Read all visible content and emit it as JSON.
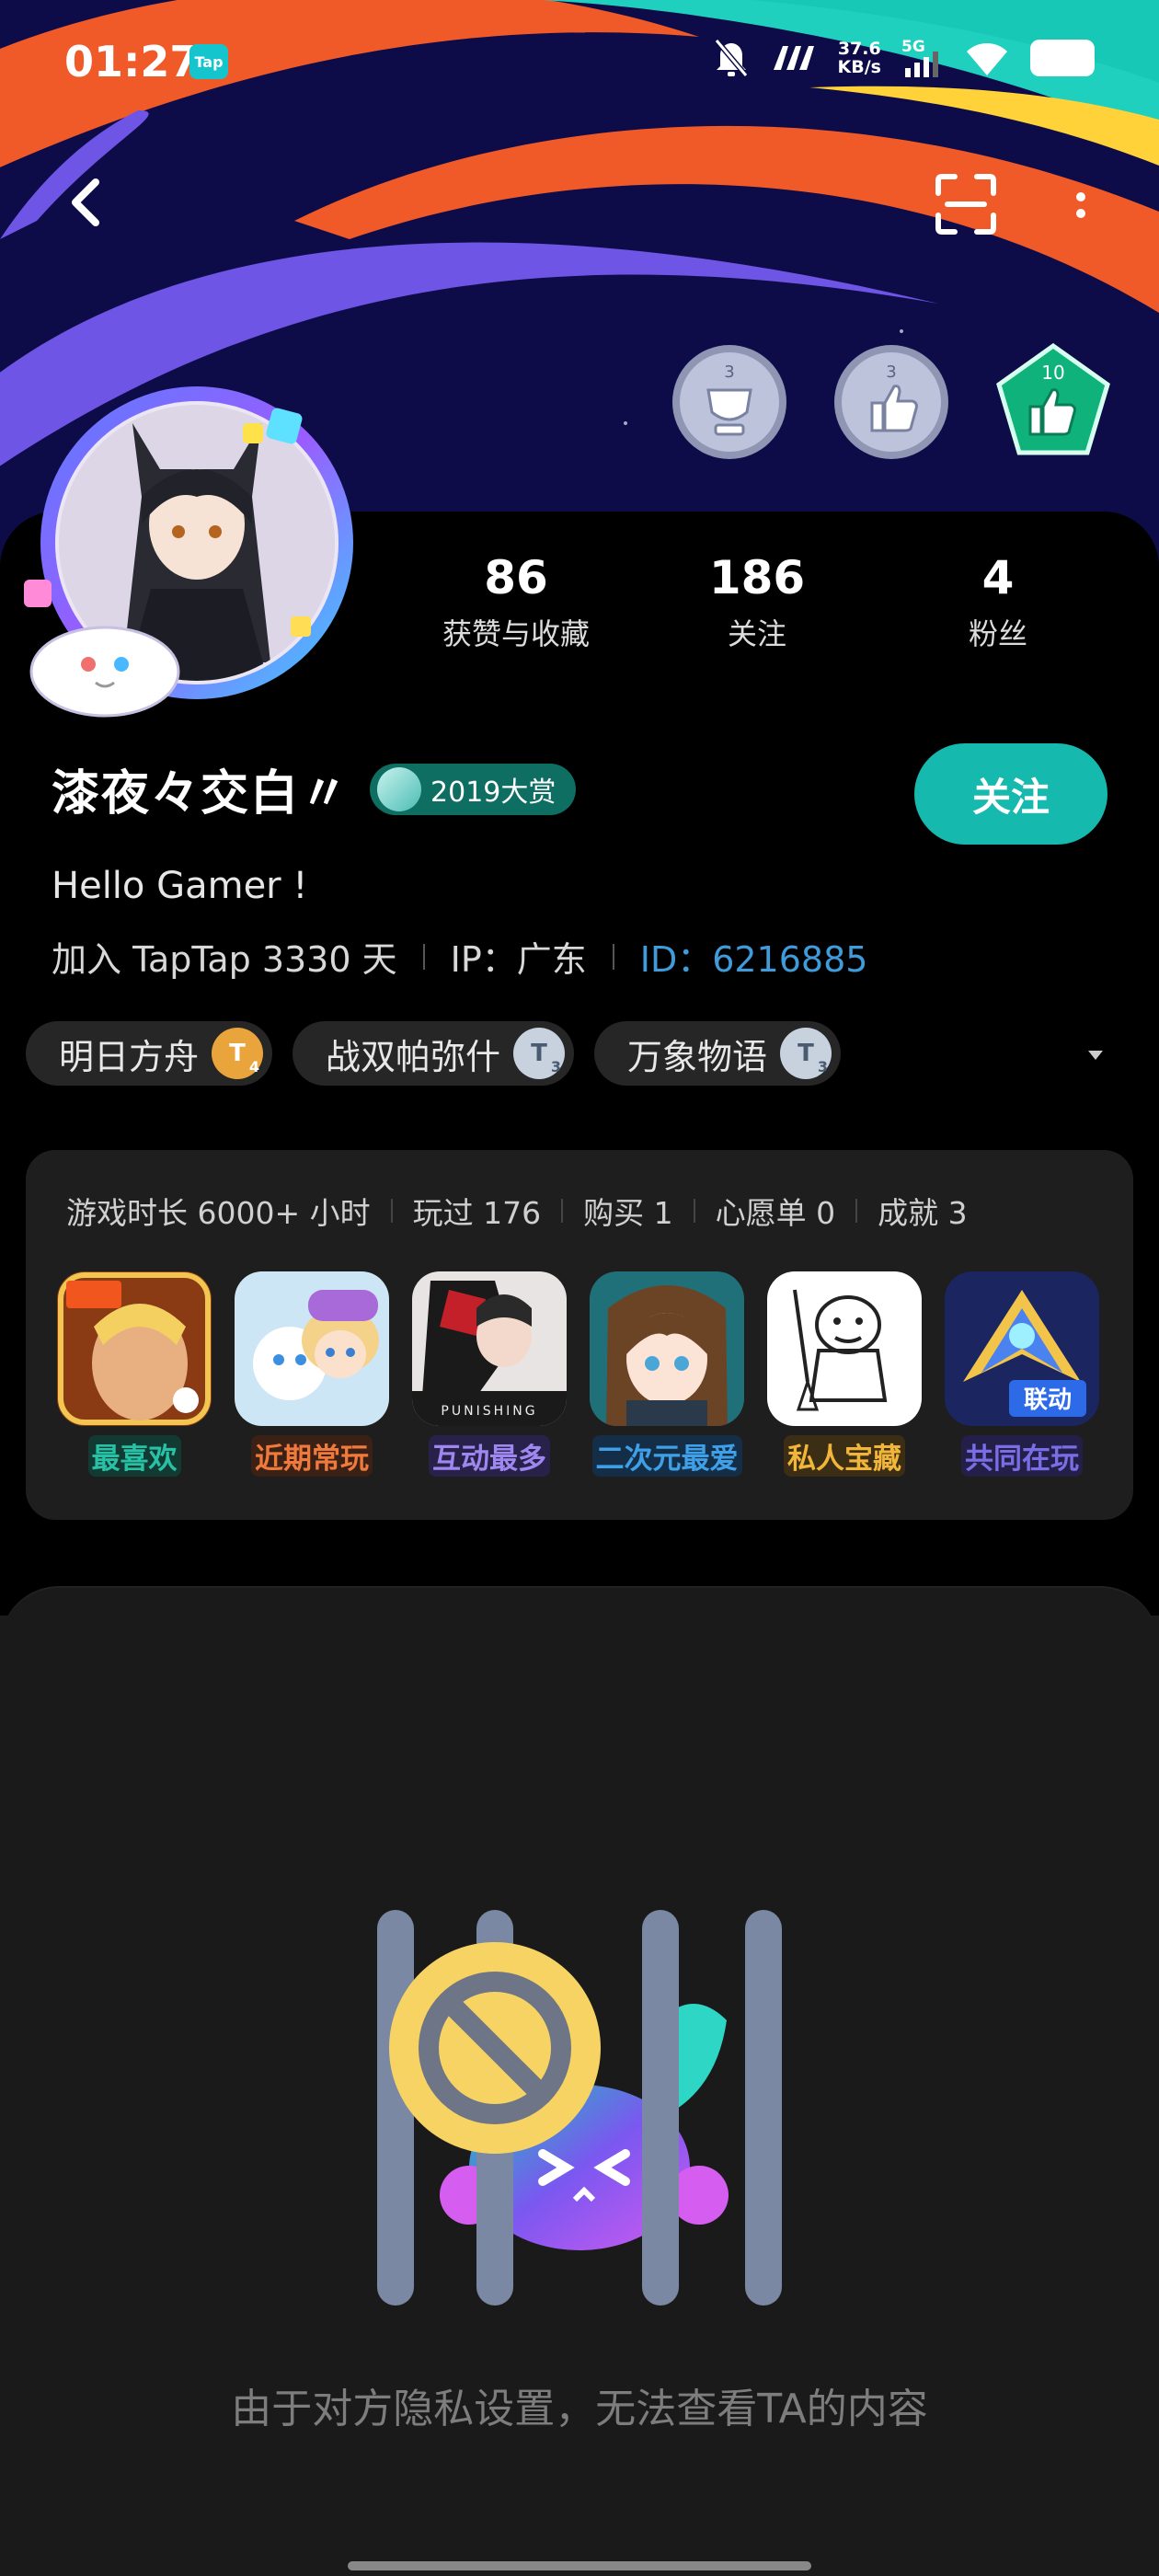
{
  "status_bar": {
    "time": "01:27",
    "app_badge": "Tap",
    "network_speed_value": "37.6",
    "network_speed_unit": "KB/s",
    "network_type": "5G"
  },
  "icons": {
    "back": "back-arrow-icon",
    "scan": "scan-icon",
    "more": "more-vertical-icon"
  },
  "badges": [
    {
      "count": "3",
      "name": "trophy-badge"
    },
    {
      "count": "3",
      "name": "thumbs-up-badge"
    },
    {
      "count": "10",
      "name": "green-thumbs-badge"
    }
  ],
  "stats": [
    {
      "value": "86",
      "label": "获赞与收藏"
    },
    {
      "value": "186",
      "label": "关注"
    },
    {
      "value": "4",
      "label": "粉丝"
    }
  ],
  "profile": {
    "name": "漆夜々交白〃",
    "award": "2019大赏",
    "follow_label": "关注",
    "bio": "Hello Gamer !",
    "join_text": "加入 TapTap 3330 天",
    "ip_text": "IP：广东",
    "id_text": "ID：6216885"
  },
  "tags": [
    {
      "name": "明日方舟",
      "level": "T",
      "sub": "4",
      "tone": "gold"
    },
    {
      "name": "战双帕弥什",
      "level": "T",
      "sub": "3",
      "tone": "silver"
    },
    {
      "name": "万象物语",
      "level": "T",
      "sub": "3",
      "tone": "silver"
    }
  ],
  "game_stats": [
    "游戏时长 6000+ 小时",
    "玩过 176",
    "购买 1",
    "心愿单 0",
    "成就 3"
  ],
  "games": [
    {
      "label": "最喜欢",
      "color": "#27c2a6",
      "bg": "#123a33"
    },
    {
      "label": "近期常玩",
      "color": "#f0793c",
      "bg": "#3a2015"
    },
    {
      "label": "互动最多",
      "color": "#9f87f0",
      "bg": "#28214a"
    },
    {
      "label": "二次元最爱",
      "color": "#3fa0e8",
      "bg": "#142e48"
    },
    {
      "label": "私人宝藏",
      "color": "#f1b53a",
      "bg": "#3b2e14"
    },
    {
      "label": "共同在玩",
      "color": "#7a6ee6",
      "bg": "#241f48"
    }
  ],
  "privacy": {
    "message": "由于对方隐私设置，无法查看TA的内容"
  }
}
